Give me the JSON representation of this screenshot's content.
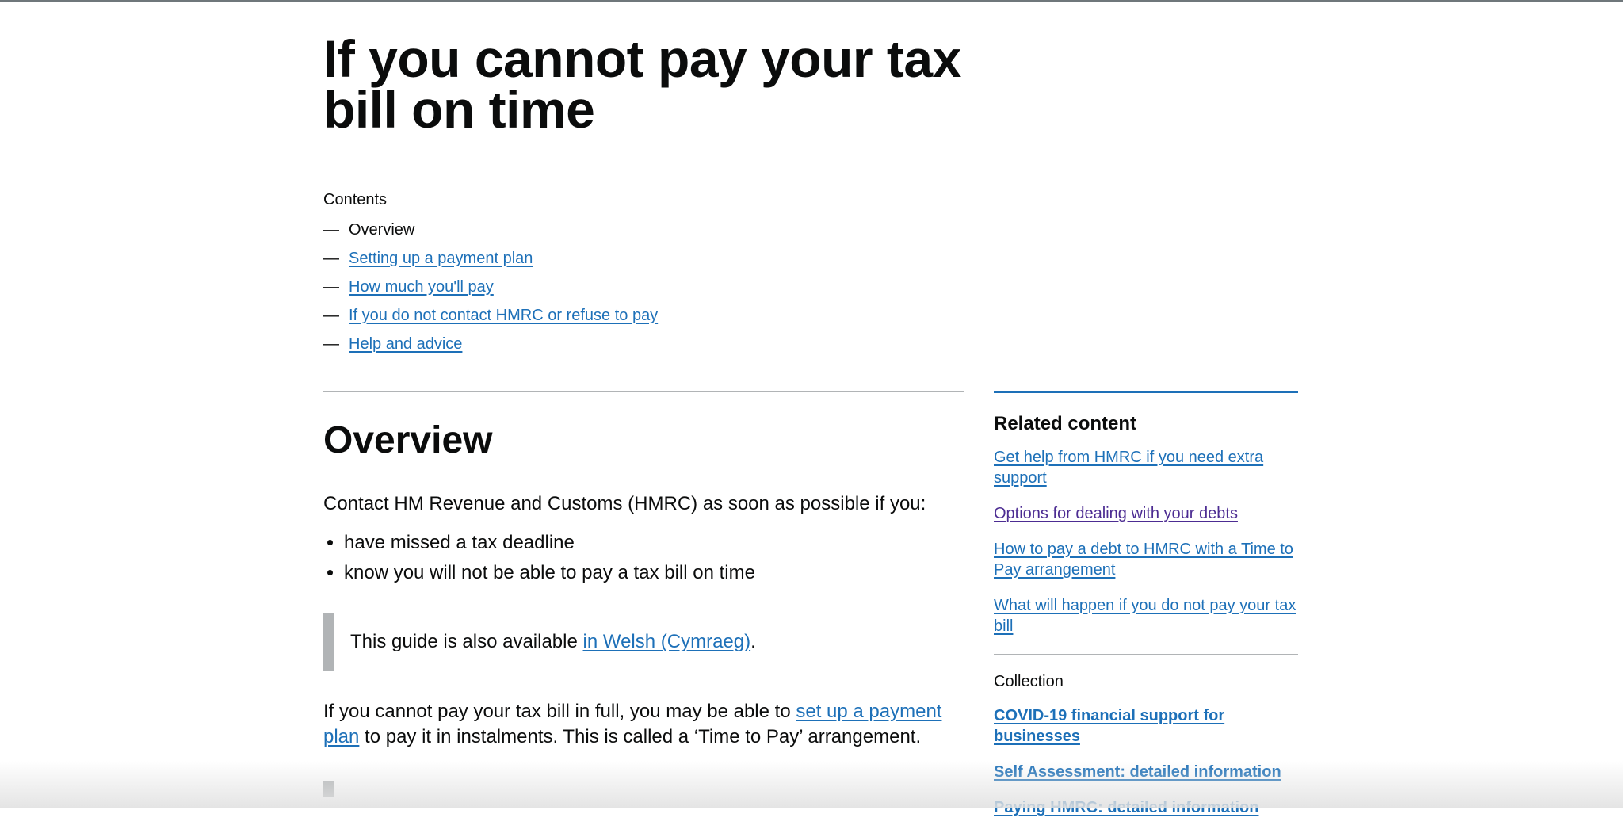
{
  "page": {
    "title": "If you cannot pay your tax bill on time"
  },
  "contents": {
    "label": "Contents",
    "dash": "—",
    "items": [
      {
        "label": "Overview"
      },
      {
        "label": "Setting up a payment plan"
      },
      {
        "label": "How much you'll pay"
      },
      {
        "label": "If you do not contact HMRC or refuse to pay"
      },
      {
        "label": "Help and advice"
      }
    ]
  },
  "main": {
    "heading": "Overview",
    "lead": "Contact HM Revenue and Customs (HMRC) as soon as possible if you:",
    "bullets": [
      "have missed a tax deadline",
      "know you will not be able to pay a tax bill on time"
    ],
    "inset": {
      "text_before": "This guide is also available ",
      "link": "in Welsh (Cymraeg)",
      "text_after": "."
    },
    "para": {
      "text_before": "If you cannot pay your tax bill in full, you may be able to ",
      "link": "set up a payment plan",
      "text_after": " to pay it in instalments. This is called a ‘Time to Pay’ arrangement."
    }
  },
  "sidebar": {
    "related_title": "Related content",
    "related_links": [
      {
        "label": "Get help from HMRC if you need extra support"
      },
      {
        "label": "Options for dealing with your debts"
      },
      {
        "label": "How to pay a debt to HMRC with a Time to Pay arrangement"
      },
      {
        "label": "What will happen if you do not pay your tax bill"
      }
    ],
    "collection_title": "Collection",
    "collection_links": [
      {
        "label": "COVID-19 financial support for businesses"
      },
      {
        "label": "Self Assessment: detailed information"
      },
      {
        "label": "Paying HMRC: detailed information"
      }
    ]
  },
  "colors": {
    "link": "#1d70b8",
    "visited_link": "#4c2c92",
    "text": "#0b0c0c",
    "border": "#b1b4b6"
  }
}
